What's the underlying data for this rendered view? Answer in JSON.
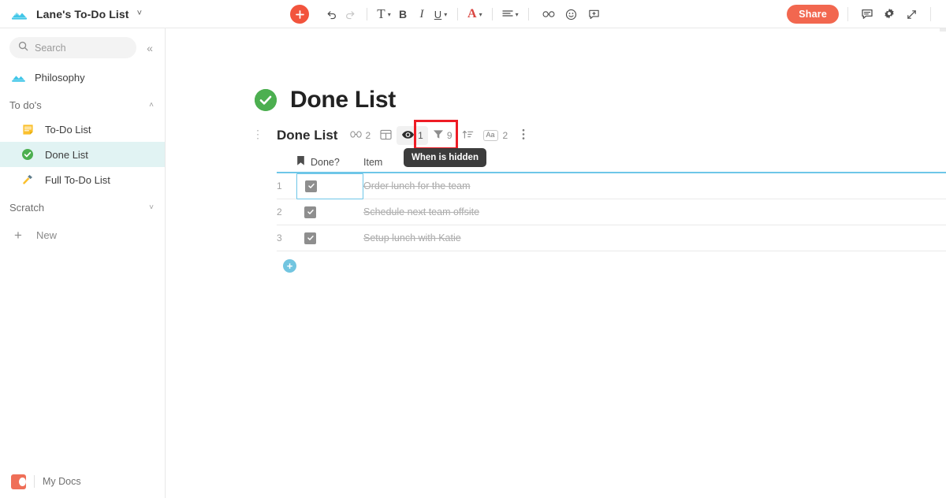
{
  "topbar": {
    "doc_icon": "books-icon",
    "doc_title": "Lane's To-Do List",
    "chevron": "˅",
    "toolbar": [
      {
        "name": "add-block-button",
        "glyph": "+",
        "kind": "plus-red"
      },
      {
        "name": "undo-button",
        "glyph": "↶",
        "kind": "icon"
      },
      {
        "name": "redo-button",
        "glyph": "↷",
        "kind": "icon-dim"
      },
      {
        "name": "text-style-button",
        "glyph": "T",
        "kind": "serif-caret"
      },
      {
        "name": "bold-button",
        "glyph": "B",
        "kind": "bold"
      },
      {
        "name": "italic-button",
        "glyph": "I",
        "kind": "italic"
      },
      {
        "name": "underline-button",
        "glyph": "U",
        "kind": "underline-caret"
      },
      {
        "name": "font-color-button",
        "glyph": "A",
        "kind": "red-caret"
      },
      {
        "name": "align-button",
        "glyph": "≡",
        "kind": "align-caret"
      },
      {
        "name": "link-button",
        "glyph": "link",
        "kind": "icon"
      },
      {
        "name": "emoji-button",
        "glyph": "emoji",
        "kind": "icon"
      },
      {
        "name": "comment-insert-button",
        "glyph": "comment-plus",
        "kind": "icon"
      }
    ],
    "share_label": "Share",
    "right_icons": [
      {
        "name": "comments-icon"
      },
      {
        "name": "settings-gear-icon"
      },
      {
        "name": "expand-fullscreen-icon"
      }
    ]
  },
  "sidebar": {
    "search_placeholder": "Search",
    "collapse_glyph": "«",
    "top_item": {
      "label": "Philosophy",
      "icon": "books-icon"
    },
    "groups": [
      {
        "label": "To do's",
        "expanded": true,
        "chevron": "˄",
        "items": [
          {
            "label": "To-Do List",
            "icon": "note-icon",
            "selected": false
          },
          {
            "label": "Done List",
            "icon": "green-check-icon",
            "selected": true
          },
          {
            "label": "Full To-Do List",
            "icon": "hammer-icon",
            "selected": false
          }
        ]
      },
      {
        "label": "Scratch",
        "expanded": false,
        "chevron": "˅",
        "items": []
      }
    ],
    "new_label": "New",
    "footer_label": "My Docs"
  },
  "page": {
    "emoji": "green-check-icon",
    "title": "Done List"
  },
  "table": {
    "name": "Done List",
    "drag_handle": "⋮",
    "chips": [
      {
        "name": "table-link-chip",
        "icon": "link-icon",
        "count": "2",
        "active": false
      },
      {
        "name": "table-layout-chip",
        "icon": "grid-icon",
        "count": "",
        "active": false
      },
      {
        "name": "table-hidden-columns-chip",
        "icon": "eye-icon",
        "count": "1",
        "active": true
      },
      {
        "name": "table-filter-chip",
        "icon": "filter-icon",
        "count": "9",
        "active": false
      },
      {
        "name": "table-sort-chip",
        "icon": "sort-icon",
        "count": "",
        "active": false
      },
      {
        "name": "table-font-chip",
        "icon": "aa-icon",
        "count": "2",
        "active": false
      },
      {
        "name": "table-more-options-chip",
        "icon": "kebab-icon",
        "count": "",
        "active": false
      }
    ],
    "tooltip": "When is hidden",
    "columns": [
      {
        "label": "Done?",
        "icon": "bookmark-icon"
      },
      {
        "label": "Item",
        "icon": ""
      }
    ],
    "rows": [
      {
        "num": "1",
        "done": true,
        "item": "Order lunch for the team",
        "selected": true
      },
      {
        "num": "2",
        "done": true,
        "item": "Schedule next team offsite",
        "selected": false
      },
      {
        "num": "3",
        "done": true,
        "item": "Setup lunch with Katie",
        "selected": false
      }
    ],
    "add_row_glyph": "+",
    "add_column_glyph": "+"
  },
  "colors": {
    "accent_red": "#f2543d",
    "share_red": "#f2674f",
    "highlight_red": "#ee1c25",
    "selection_blue": "#6ec6e8",
    "add_blue": "#72c5e0",
    "selected_item_bg": "#e1f3f3",
    "check_green": "#4caf50",
    "tooltip_bg": "#3c3c3c"
  }
}
